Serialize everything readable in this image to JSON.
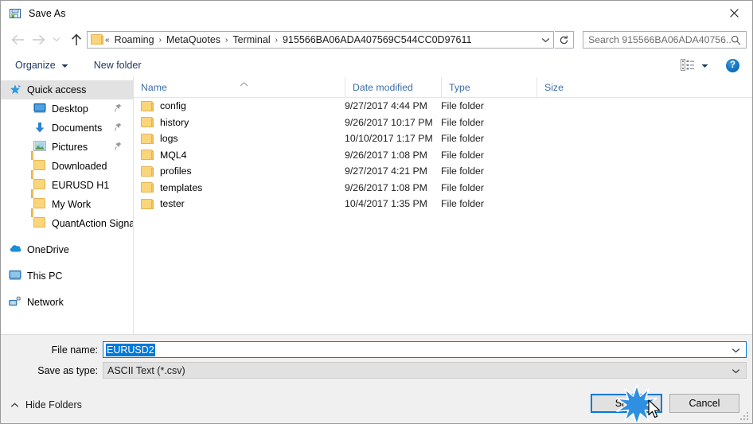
{
  "window": {
    "title": "Save As",
    "icon": "save-as-app-icon",
    "close_label": "✕"
  },
  "nav": {
    "back_icon": "arrow-left-icon",
    "forward_icon": "arrow-right-icon",
    "recent_icon": "chevron-down-icon",
    "up_icon": "arrow-up-icon",
    "address": {
      "folder_icon": "folder-icon",
      "prefix": "«",
      "crumbs": [
        "Roaming",
        "MetaQuotes",
        "Terminal",
        "915566BA06ADA407569C544CC0D97611"
      ],
      "separator": "›",
      "dropdown_icon": "chevron-down-icon",
      "refresh_icon": "refresh-icon"
    },
    "search": {
      "placeholder": "Search 915566BA06ADA40756...",
      "icon": "search-icon"
    }
  },
  "toolbar": {
    "organize_label": "Organize",
    "organize_caret": "caret-down-icon",
    "new_folder_label": "New folder",
    "view_icon": "view-mode-icon",
    "view_caret": "caret-down-icon",
    "help_label": "?",
    "help_icon": "help-icon"
  },
  "navpane": {
    "items": [
      {
        "label": "Quick access",
        "icon": "quick-access-star-icon",
        "level": "root",
        "selected": true,
        "pinned": false
      },
      {
        "label": "Desktop",
        "icon": "desktop-icon",
        "level": "lvl1",
        "selected": false,
        "pinned": true
      },
      {
        "label": "Documents",
        "icon": "documents-icon",
        "level": "lvl1",
        "selected": false,
        "pinned": true
      },
      {
        "label": "Pictures",
        "icon": "pictures-icon",
        "level": "lvl1",
        "selected": false,
        "pinned": true
      },
      {
        "label": "Downloaded",
        "icon": "folder-icon",
        "level": "lvl1",
        "selected": false,
        "pinned": false
      },
      {
        "label": "EURUSD H1",
        "icon": "folder-icon",
        "level": "lvl1",
        "selected": false,
        "pinned": false
      },
      {
        "label": "My Work",
        "icon": "folder-icon",
        "level": "lvl1",
        "selected": false,
        "pinned": false
      },
      {
        "label": "QuantAction Signal",
        "icon": "folder-icon",
        "level": "lvl1",
        "selected": false,
        "pinned": false
      }
    ],
    "roots": [
      {
        "label": "OneDrive",
        "icon": "onedrive-cloud-icon"
      },
      {
        "label": "This PC",
        "icon": "this-pc-icon"
      },
      {
        "label": "Network",
        "icon": "network-icon"
      }
    ]
  },
  "filelist": {
    "columns": [
      "Name",
      "Date modified",
      "Type",
      "Size"
    ],
    "sort_indicator": "sort-ascending-caret-icon",
    "rows": [
      {
        "name": "config",
        "date": "9/27/2017 4:44 PM",
        "type": "File folder",
        "size": ""
      },
      {
        "name": "history",
        "date": "9/26/2017 10:17 PM",
        "type": "File folder",
        "size": ""
      },
      {
        "name": "logs",
        "date": "10/10/2017 1:17 PM",
        "type": "File folder",
        "size": ""
      },
      {
        "name": "MQL4",
        "date": "9/26/2017 1:08 PM",
        "type": "File folder",
        "size": ""
      },
      {
        "name": "profiles",
        "date": "9/27/2017 4:21 PM",
        "type": "File folder",
        "size": ""
      },
      {
        "name": "templates",
        "date": "9/26/2017 1:08 PM",
        "type": "File folder",
        "size": ""
      },
      {
        "name": "tester",
        "date": "10/4/2017 1:35 PM",
        "type": "File folder",
        "size": ""
      }
    ]
  },
  "form": {
    "file_name_label": "File name:",
    "file_name_value": "EURUSD2",
    "save_as_type_label": "Save as type:",
    "save_as_type_value": "ASCII Text (*.csv)",
    "caret_icon": "chevron-down-icon"
  },
  "footer": {
    "hide_folders_label": "Hide Folders",
    "hide_folders_icon": "caret-up-icon",
    "save_label": "Save",
    "cancel_label": "Cancel",
    "resize_grip": "resize-grip-icon",
    "cursor": "mouse-pointer-icon",
    "click_effect": "click-burst-icon"
  },
  "colors": {
    "accent": "#0078d7",
    "folder_yellow": "#fbd57a",
    "header_text": "#3b6ea5",
    "dialog_bg": "#f0f0f0"
  }
}
